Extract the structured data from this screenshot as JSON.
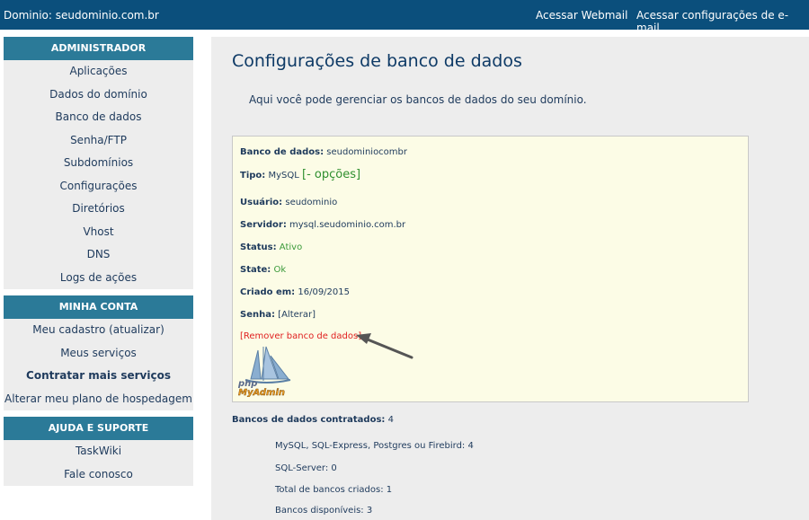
{
  "topbar": {
    "domain_text": "Dominio: seudominio.com.br",
    "webmail_link": "Acessar Webmail",
    "email_settings_link": "Acessar configurações de e-mail"
  },
  "sidebar": {
    "admin": {
      "header": "ADMINISTRADOR",
      "items": [
        "Aplicações",
        "Dados do domínio",
        "Banco de dados",
        "Senha/FTP",
        "Subdomínios",
        "Configurações",
        "Diretórios",
        "Vhost",
        "DNS",
        "Logs de ações"
      ]
    },
    "account": {
      "header": "MINHA CONTA",
      "items": [
        "Meu cadastro (atualizar)",
        "Meus serviços",
        "Contratar mais serviços",
        "Alterar meu plano de hospedagem"
      ]
    },
    "support": {
      "header": "AJUDA E SUPORTE",
      "items": [
        "TaskWiki",
        "Fale conosco"
      ]
    }
  },
  "main": {
    "title": "Configurações de banco de dados",
    "intro": "Aqui você pode gerenciar os bancos de dados do seu domínio.",
    "db": {
      "name_label": "Banco de dados:",
      "name_value": "seudominiocombr",
      "type_label": "Tipo:",
      "type_value": "MySQL",
      "options_link": "[- opções]",
      "user_label": "Usuário:",
      "user_value": "seudominio",
      "server_label": "Servidor:",
      "server_value": "mysql.seudominio.com.br",
      "status_label": "Status:",
      "status_value": "Ativo",
      "state_label": "State:",
      "state_value": "Ok",
      "created_label": "Criado em:",
      "created_value": "16/09/2015",
      "password_label": "Senha:",
      "password_link": "[Alterar]",
      "remove_link": "[Remover banco de dados]",
      "logo_text_top": "php",
      "logo_text_bottom": "MyAdmin"
    },
    "stats": {
      "header_label": "Bancos de dados contratados:",
      "header_value": "4",
      "lines": [
        "MySQL, SQL-Express, Postgres ou Firebird: 4",
        "SQL-Server: 0",
        "Total de bancos criados: 1",
        "Bancos disponíveis: 3"
      ]
    }
  },
  "colors": {
    "topbar": "#0b4f7c",
    "sidebar_header": "#2b7a98",
    "sidebar_bg": "#ededed",
    "box_bg": "#fcfce6",
    "status_green": "#3a9a3a",
    "remove_red": "#e02020"
  }
}
